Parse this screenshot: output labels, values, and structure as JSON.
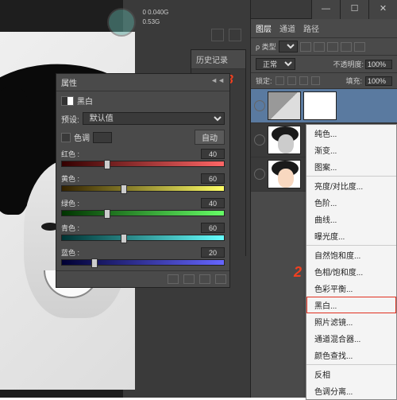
{
  "top_stats": {
    "l1": "0 0.040G",
    "l2": "0.53G"
  },
  "history": {
    "title": "历史记录"
  },
  "marker3": "3",
  "marker2": "2",
  "props": {
    "header": "属性",
    "title": "黑白",
    "preset_label": "预设:",
    "preset_value": "默认值",
    "tint_label": "色调",
    "auto_label": "自动",
    "colors": [
      {
        "name": "红色 :",
        "value": "40",
        "c1": "#330000",
        "c2": "#ff6666",
        "pos": 28
      },
      {
        "name": "黄色 :",
        "value": "60",
        "c1": "#332200",
        "c2": "#ffff66",
        "pos": 38
      },
      {
        "name": "绿色 :",
        "value": "40",
        "c1": "#003300",
        "c2": "#66ff66",
        "pos": 28
      },
      {
        "name": "青色 :",
        "value": "60",
        "c1": "#003333",
        "c2": "#66ffff",
        "pos": 38
      },
      {
        "name": "蓝色 :",
        "value": "20",
        "c1": "#000033",
        "c2": "#6666ff",
        "pos": 20
      }
    ]
  },
  "layers": {
    "tabs": [
      "图层",
      "通道",
      "路径"
    ],
    "kind_label": "ρ 类型",
    "mode": "正常",
    "opacity_label": "不透明度:",
    "opacity_value": "100%",
    "lock_label": "锁定:",
    "fill_label": "填充:",
    "fill_value": "100%"
  },
  "menu": {
    "items": [
      "纯色...",
      "渐变...",
      "图案...",
      "",
      "亮度/对比度...",
      "色阶...",
      "曲线...",
      "曝光度...",
      "",
      "自然饱和度...",
      "色相/饱和度...",
      "色彩平衡...",
      "黑白...",
      "照片滤镜...",
      "通道混合器...",
      "颜色查找...",
      "",
      "反相",
      "色调分离..."
    ],
    "highlight_index": 12
  }
}
